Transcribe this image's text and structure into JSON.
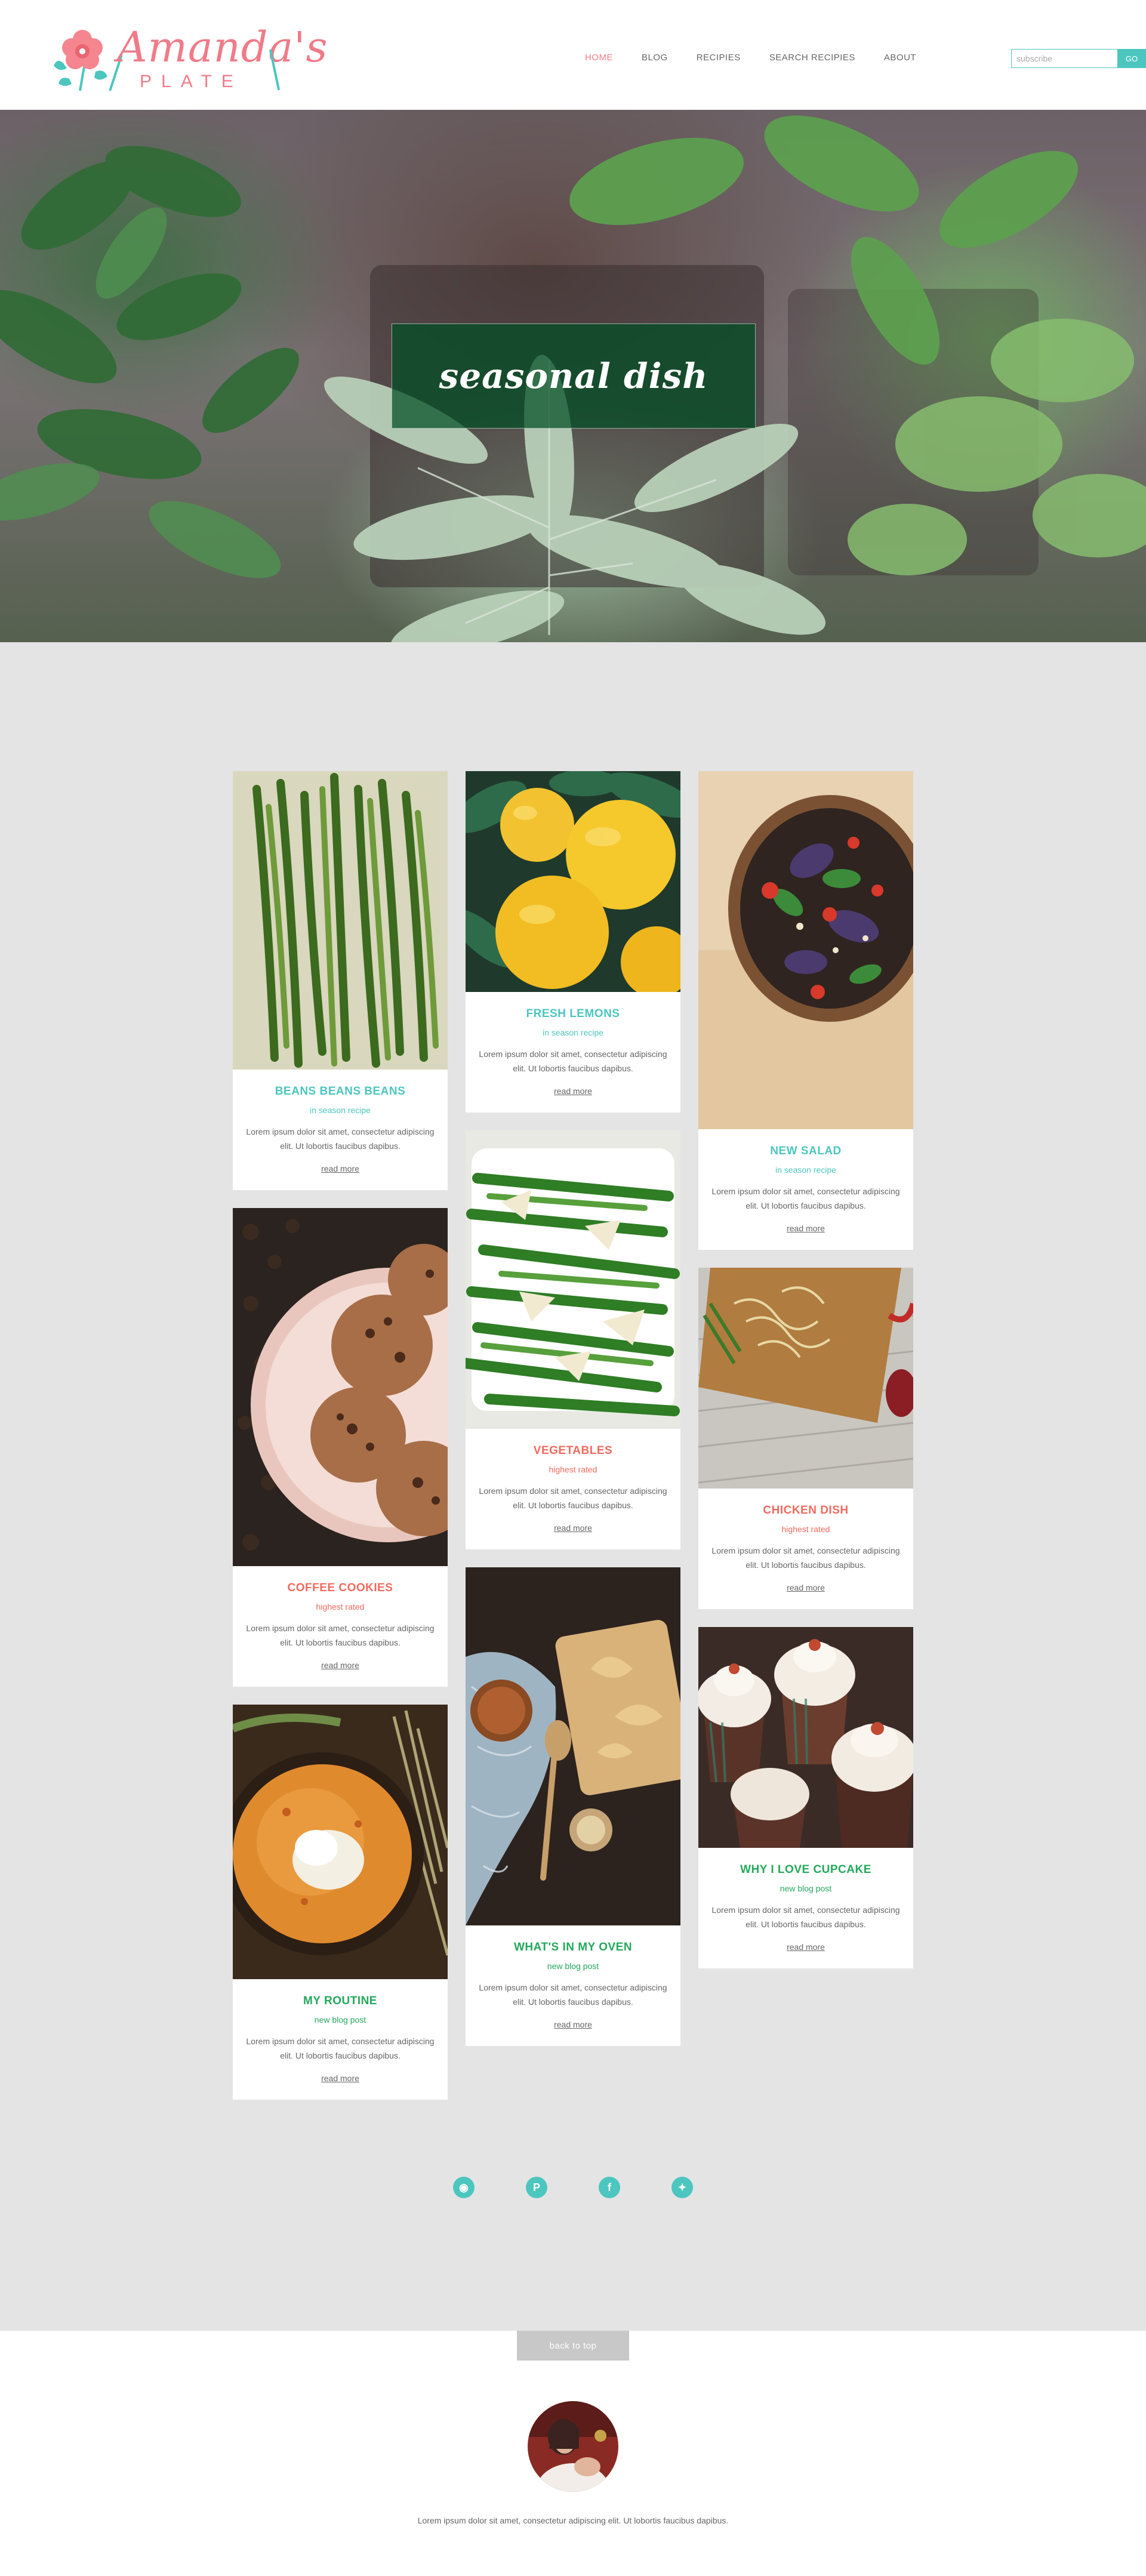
{
  "brand": {
    "logo_script": "Amanda's",
    "logo_word": "PLATE",
    "accent_pink": "#f07b88",
    "accent_teal": "#4cc6bf"
  },
  "nav": {
    "items": [
      {
        "label": "HOME",
        "active": true
      },
      {
        "label": "BLOG",
        "active": false
      },
      {
        "label": "RECIPIES",
        "active": false
      },
      {
        "label": "SEARCH RECIPIES",
        "active": false
      },
      {
        "label": "ABOUT",
        "active": false
      }
    ]
  },
  "subscribe": {
    "placeholder": "subscribe",
    "button_label": "GO"
  },
  "hero": {
    "title": "seasonal dish"
  },
  "cards": [
    {
      "title": "BEANS BEANS BEANS",
      "tag": "in season recipe",
      "text": "Lorem ipsum dolor sit amet, consectetur adipiscing elit. Ut lobortis faucibus dapibus.",
      "more": "read more",
      "image": "green-beans",
      "color": "teal"
    },
    {
      "title": "COFFEE COOKIES",
      "tag": "highest rated",
      "text": "Lorem ipsum dolor sit amet, consectetur adipiscing elit. Ut lobortis faucibus dapibus.",
      "more": "read more",
      "image": "cookies",
      "color": "coral"
    },
    {
      "title": "MY ROUTINE",
      "tag": "new blog post",
      "text": "Lorem ipsum dolor sit amet, consectetur adipiscing elit. Ut lobortis faucibus dapibus.",
      "more": "read more",
      "image": "soup",
      "color": "green"
    },
    {
      "title": "FRESH LEMONS",
      "tag": "in season recipe",
      "text": "Lorem ipsum dolor sit amet, consectetur adipiscing elit. Ut lobortis faucibus dapibus.",
      "more": "read more",
      "image": "lemons",
      "color": "teal"
    },
    {
      "title": "VEGETABLES",
      "tag": "highest rated",
      "text": "Lorem ipsum dolor sit amet, consectetur adipiscing elit. Ut lobortis faucibus dapibus.",
      "more": "read more",
      "image": "green-beans-parmesan",
      "color": "coral"
    },
    {
      "title": "WHAT'S IN MY OVEN",
      "tag": "new blog post",
      "text": "Lorem ipsum dolor sit amet, consectetur adipiscing elit. Ut lobortis faucibus dapibus.",
      "more": "read more",
      "image": "pastries",
      "color": "green"
    },
    {
      "title": "NEW SALAD",
      "tag": "in season recipe",
      "text": "Lorem ipsum dolor sit amet, consectetur adipiscing elit. Ut lobortis faucibus dapibus.",
      "more": "read more",
      "image": "salad",
      "color": "teal"
    },
    {
      "title": "CHICKEN DISH",
      "tag": "highest rated",
      "text": "Lorem ipsum dolor sit amet, consectetur adipiscing elit. Ut lobortis faucibus dapibus.",
      "more": "read more",
      "image": "noodles",
      "color": "coral"
    },
    {
      "title": "WHY I LOVE CUPCAKE",
      "tag": "new blog post",
      "text": "Lorem ipsum dolor sit amet, consectetur adipiscing elit. Ut lobortis faucibus dapibus.",
      "more": "read more",
      "image": "cupcakes",
      "color": "green"
    }
  ],
  "social": [
    {
      "name": "rss-icon",
      "glyph": "◉"
    },
    {
      "name": "pinterest-icon",
      "glyph": "P"
    },
    {
      "name": "facebook-icon",
      "glyph": "f"
    },
    {
      "name": "twitter-icon",
      "glyph": "✦"
    }
  ],
  "footer": {
    "back_to_top": "back to top",
    "text": "Lorem ipsum dolor sit amet, consectetur adipiscing elit. Ut lobortis faucibus dapibus."
  }
}
